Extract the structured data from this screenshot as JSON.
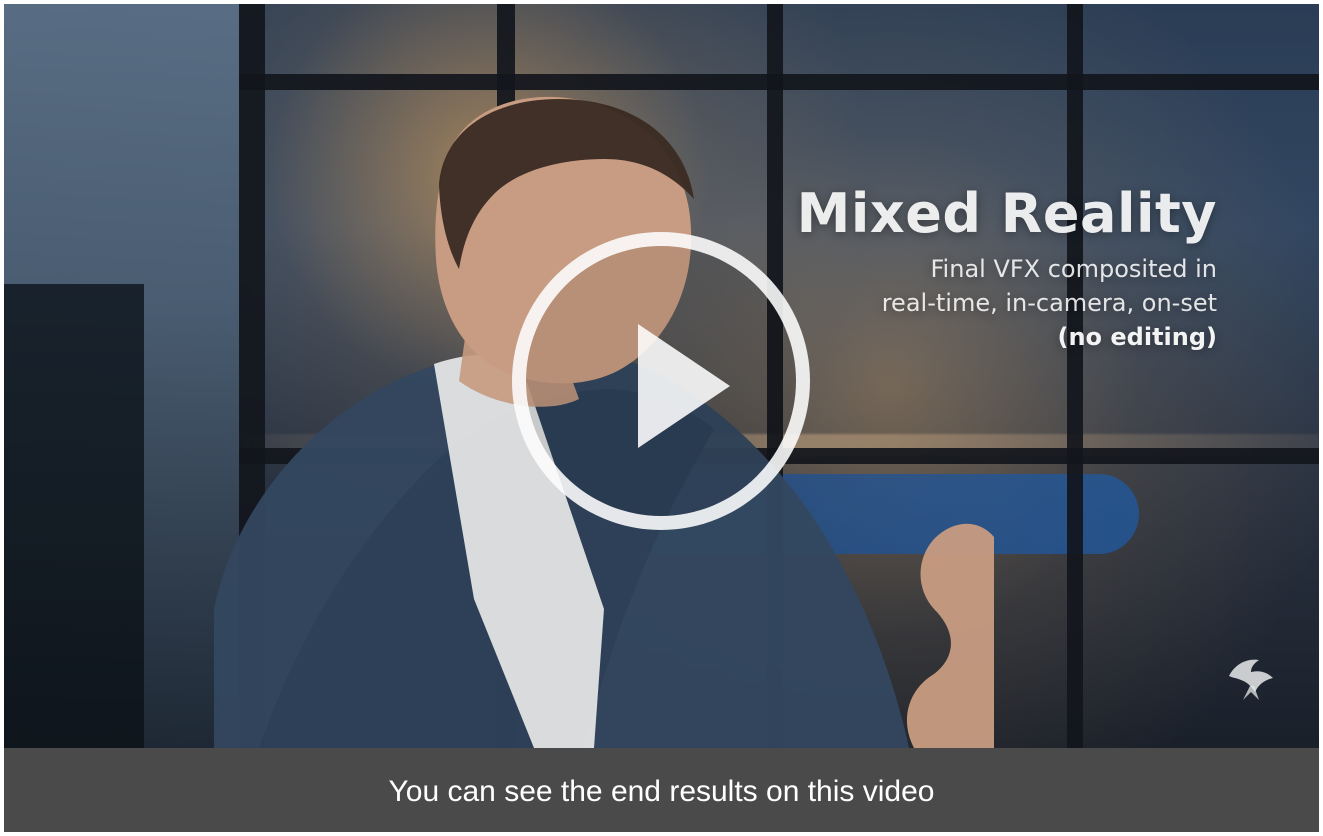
{
  "video": {
    "title": "Mixed Reality",
    "subtitle_lines": [
      "Final VFX composited in",
      "real-time, in-camera, on-set"
    ],
    "emphasis_line": "(no editing)",
    "play_button_label": "Play"
  },
  "caption": {
    "text": "You can see the end results on this video"
  },
  "icons": {
    "play": "play-icon",
    "logo": "bird-logo-icon"
  },
  "colors": {
    "caption_bar": "#4a4a4a",
    "text": "#ffffff"
  }
}
